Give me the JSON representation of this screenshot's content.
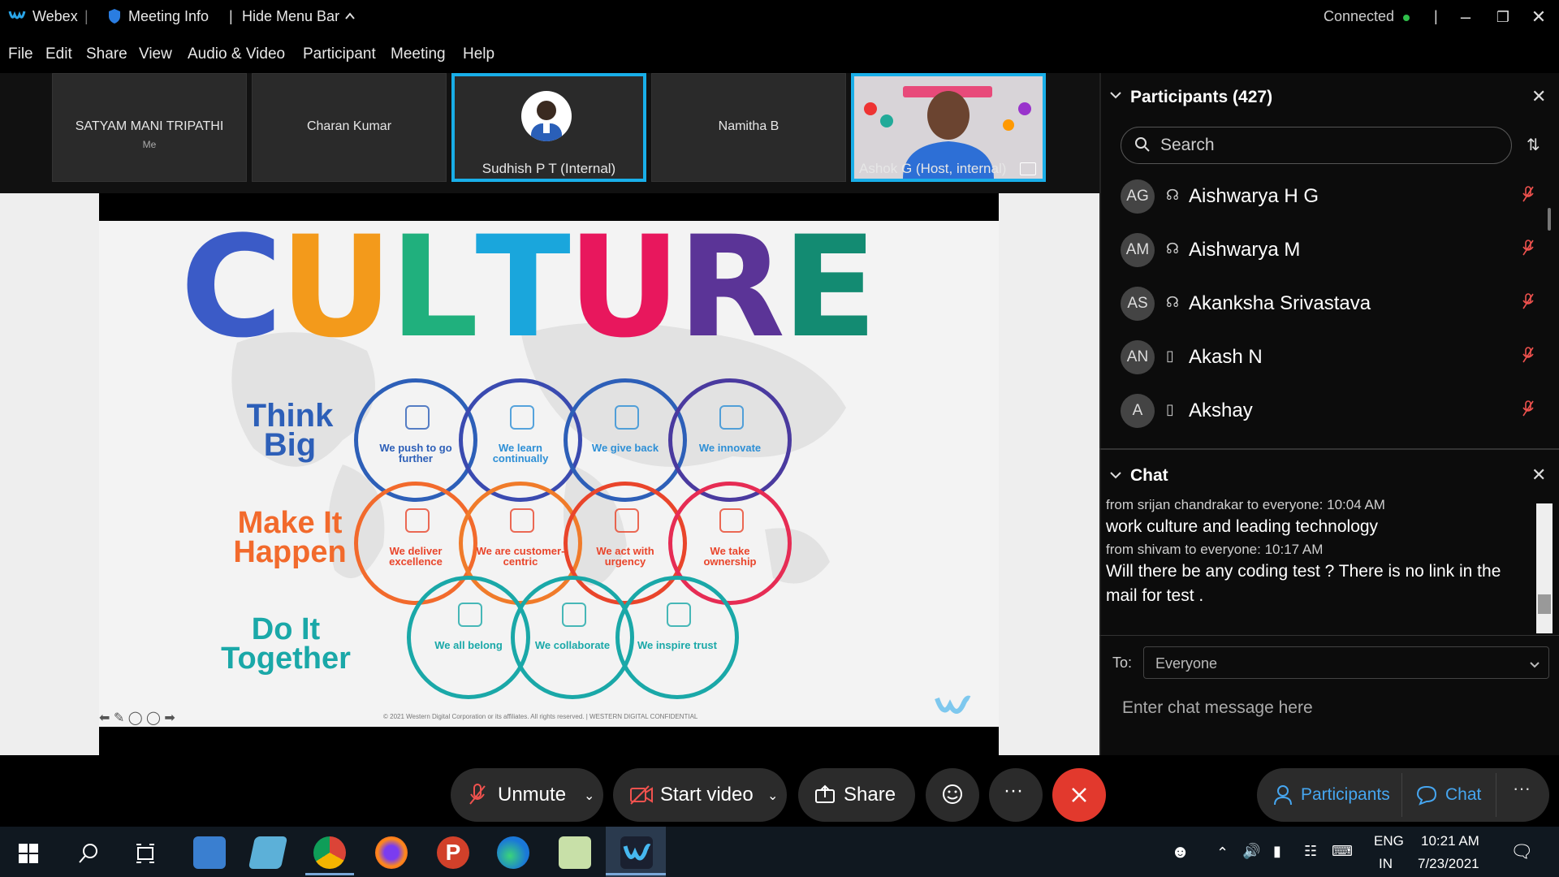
{
  "titlebar": {
    "app_name": "Webex",
    "meeting_info": "Meeting Info",
    "hide_menu": "Hide Menu Bar",
    "connection_status": "Connected"
  },
  "menu": [
    "File",
    "Edit",
    "Share",
    "View",
    "Audio & Video",
    "Participant",
    "Meeting",
    "Help"
  ],
  "video_tiles": [
    {
      "name": "SATYAM MANI TRIPATHI",
      "sub": "Me",
      "active": false
    },
    {
      "name": "Charan Kumar",
      "active": false
    },
    {
      "name": "Sudhish P T  (Internal)",
      "active": true,
      "has_avatar": true
    },
    {
      "name": "Namitha B",
      "active": false
    },
    {
      "name": "Ashok G  (Host, internal)",
      "active": true,
      "has_video": true
    }
  ],
  "slide": {
    "title_letters": [
      {
        "ch": "C",
        "color": "#3b5bc7"
      },
      {
        "ch": "U",
        "color": "#f39a1b"
      },
      {
        "ch": "L",
        "color": "#20b07d"
      },
      {
        "ch": "T",
        "color": "#1aa6dc"
      },
      {
        "ch": "U",
        "color": "#e8175d"
      },
      {
        "ch": "R",
        "color": "#5b3497"
      },
      {
        "ch": "E",
        "color": "#138b72"
      }
    ],
    "groups": [
      {
        "label_line1": "Think",
        "label_line2": "Big",
        "color": "#2d5fb8"
      },
      {
        "label_line1": "Make It",
        "label_line2": "Happen",
        "color": "#f26a2c"
      },
      {
        "label_line1": "Do It",
        "label_line2": "Together",
        "color": "#1aa8a8"
      }
    ],
    "row1": [
      {
        "text": "We push to go further",
        "ring": "#2d5fb8",
        "text_color": "#2d5fb8"
      },
      {
        "text": "We learn continually",
        "ring": "#3a4ab0",
        "text_color": "#2d8fd6"
      },
      {
        "text": "We give back",
        "ring": "#2d5fb8",
        "text_color": "#2d8fd6"
      },
      {
        "text": "We innovate",
        "ring": "#4a3a9f",
        "text_color": "#2d8fd6"
      }
    ],
    "row2": [
      {
        "text": "We deliver excellence",
        "ring": "#f26a2c",
        "text_color": "#e9452b"
      },
      {
        "text": "We are customer-centric",
        "ring": "#f07b2a",
        "text_color": "#e9452b"
      },
      {
        "text": "We act with urgency",
        "ring": "#e9452b",
        "text_color": "#e9452b"
      },
      {
        "text": "We take ownership",
        "ring": "#e62c54",
        "text_color": "#e9452b"
      }
    ],
    "row3": [
      {
        "text": "We all belong",
        "ring": "#1aa8a8",
        "text_color": "#1aa8a8"
      },
      {
        "text": "We collaborate",
        "ring": "#1aa8a8",
        "text_color": "#1aa8a8"
      },
      {
        "text": "We inspire trust",
        "ring": "#1aa8a8",
        "text_color": "#1aa8a8"
      }
    ],
    "footer": "© 2021 Western Digital Corporation or its affiliates. All rights reserved.  |  WESTERN DIGITAL CONFIDENTIAL",
    "stripe_colors": [
      "#f26a2c",
      "#2d5fb8",
      "#1aa8a8",
      "#1aa6dc",
      "#e8175d",
      "#5b3497",
      "#999999"
    ]
  },
  "participants": {
    "header": "Participants (427)",
    "search_placeholder": "Search",
    "list": [
      {
        "initials": "AG",
        "name": "Aishwarya H G",
        "device": "headset"
      },
      {
        "initials": "AM",
        "name": "Aishwarya M",
        "device": "headset"
      },
      {
        "initials": "AS",
        "name": "Akanksha Srivastava",
        "device": "headset"
      },
      {
        "initials": "AN",
        "name": "Akash N",
        "device": "phone"
      },
      {
        "initials": "A",
        "name": "Akshay",
        "device": "phone"
      }
    ]
  },
  "chat": {
    "header": "Chat",
    "messages": [
      {
        "meta": "from srijan chandrakar to everyone:    10:04 AM",
        "text": "work culture and leading technology"
      },
      {
        "meta": "from shivam to everyone:    10:17 AM",
        "text": "Will there be any coding test ? There is no link in the mail for test ."
      }
    ],
    "to_label": "To:",
    "to_value": "Everyone",
    "input_placeholder": "Enter chat message here"
  },
  "controls": {
    "unmute": "Unmute",
    "start_video": "Start video",
    "share": "Share",
    "participants": "Participants",
    "chat": "Chat",
    "more": "···"
  },
  "taskbar": {
    "lang1": "ENG",
    "lang2": "IN",
    "time": "10:21 AM",
    "date": "7/23/2021"
  }
}
